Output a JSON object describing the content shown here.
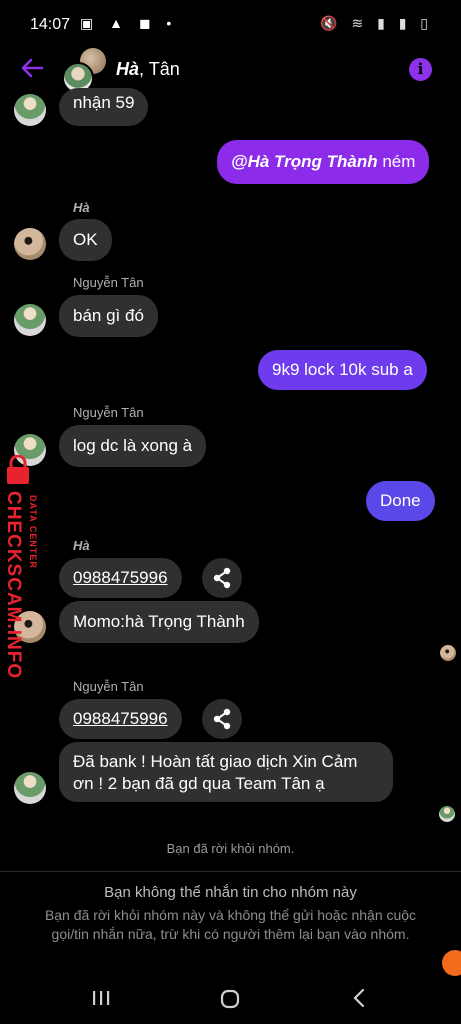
{
  "status_bar": {
    "time": "14:07",
    "left_icons": "▣ ▲ ◼ •",
    "right_icons": "🔇 ≋ ▮ ▮ ▯"
  },
  "header": {
    "title_bold": "Hà",
    "title_rest": ", Tân"
  },
  "messages": {
    "m1": "nhận 59",
    "m2_mention": "@Hà Trọng Thành",
    "m2_rest": " ném",
    "sender_ha_1": "Hà",
    "m3": "OK",
    "sender_tan_1": "Nguyễn Tân",
    "m4": "bán gì đó",
    "m5": "9k9 lock 10k sub a",
    "sender_tan_2": "Nguyễn Tân",
    "m6": "log dc là xong à",
    "m7": "Done",
    "sender_ha_2": "Hà",
    "m8": "0988475996",
    "m9": "Momo:hà Trọng Thành",
    "sender_tan_3": "Nguyễn Tân",
    "m10": "0988475996",
    "m11_line1": "Đã bank ! Hoàn tất giao dịch Xin Cảm",
    "m11_line2": "ơn ! 2 bạn đã gd qua Team Tân ạ"
  },
  "system_note": "Bạn đã rời khỏi nhóm.",
  "footer": {
    "title": "Bạn không thể nhắn tin cho nhóm này",
    "body": "Bạn đã rời khỏi nhóm này và không thể gửi hoặc nhận cuộc gọi/tin nhắn nữa, trừ khi có người thêm lại bạn vào nhóm."
  },
  "watermark": {
    "main": "CHECKSCAM.INFO",
    "sub": "DATA CENTER"
  },
  "colors": {
    "accent": "#8e31ea",
    "bubble_grey": "#303030",
    "bubble_blue": "#5a48e8"
  },
  "icons": [
    "back-arrow-icon",
    "info-icon",
    "share-icon",
    "recents-icon",
    "home-icon",
    "back-nav-icon"
  ]
}
